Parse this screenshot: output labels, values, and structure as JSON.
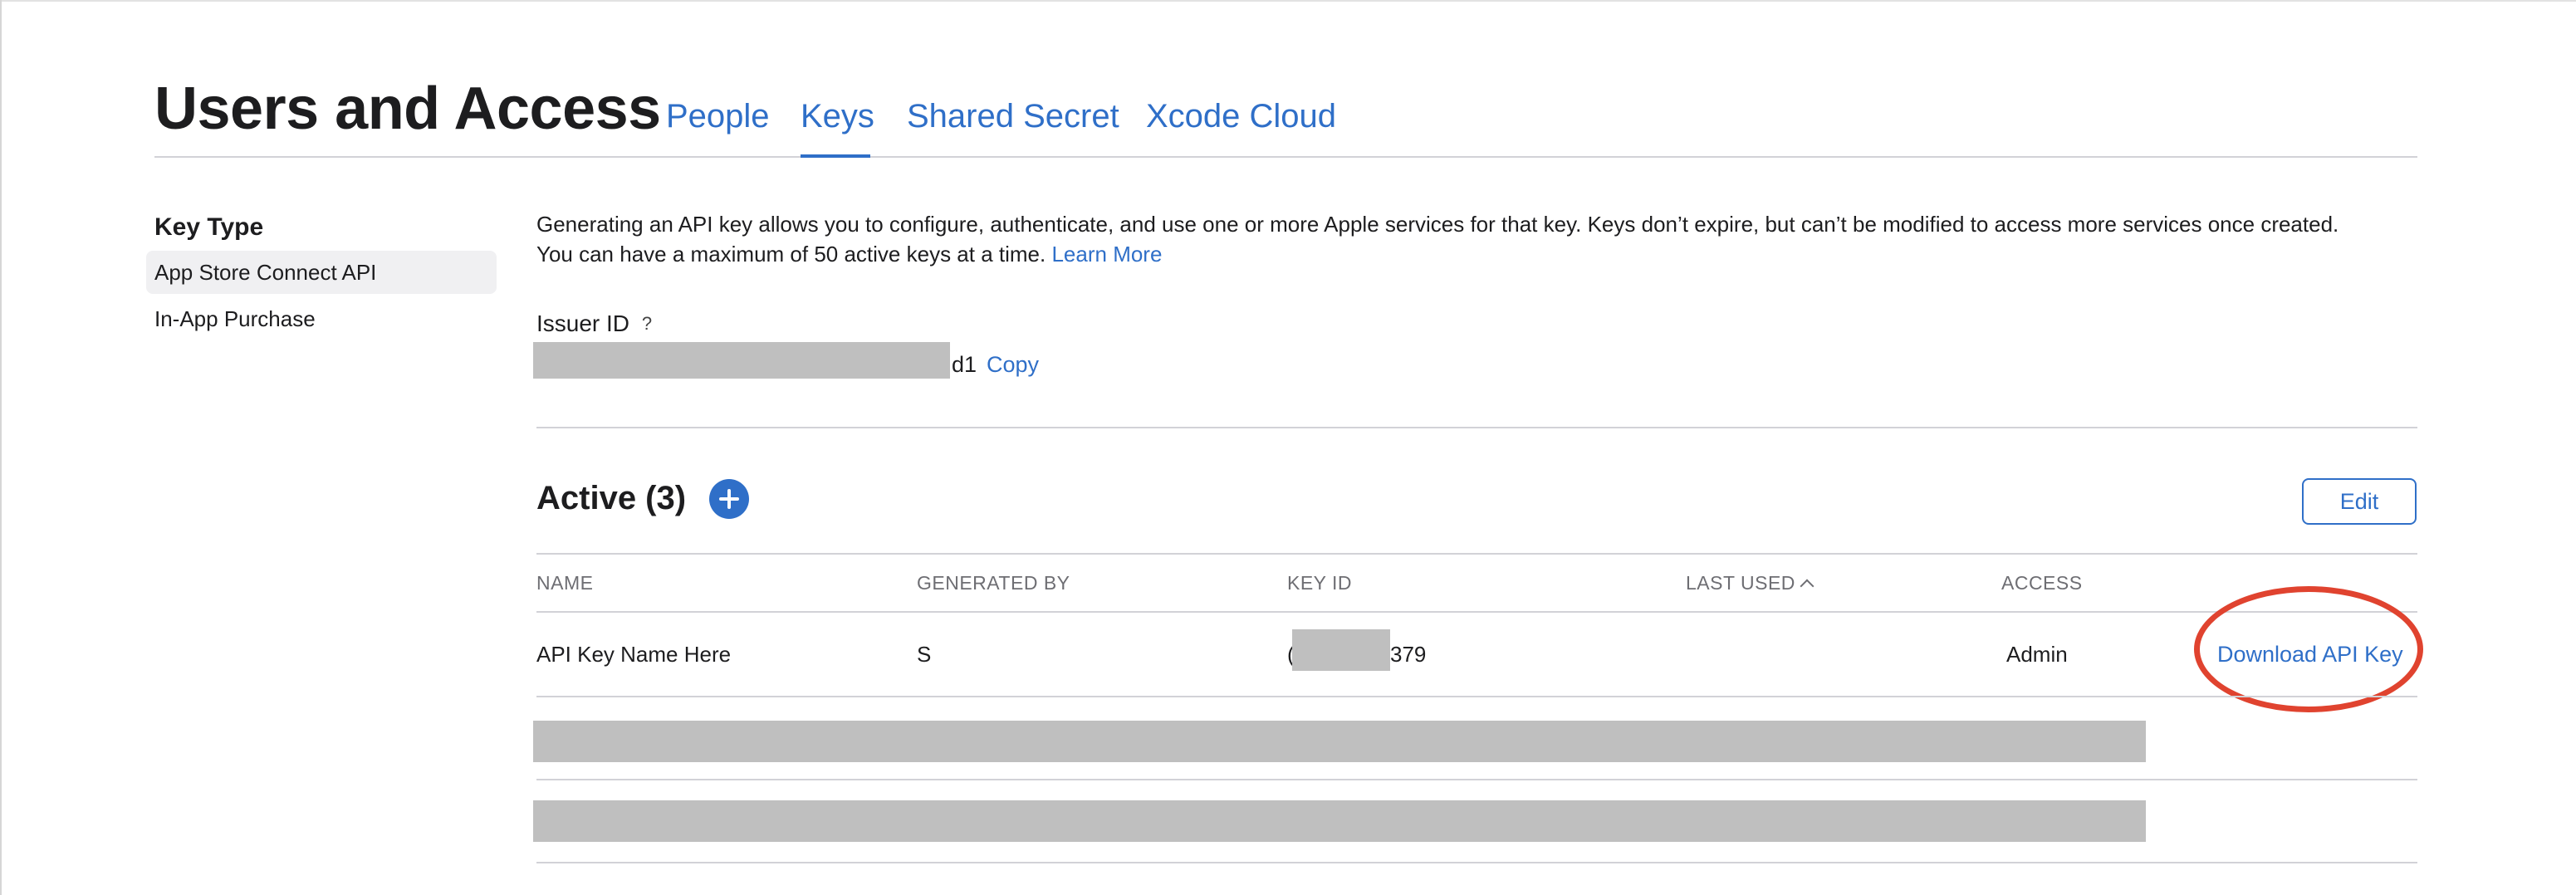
{
  "header": {
    "title": "Users and Access",
    "tabs": [
      {
        "label": "People"
      },
      {
        "label": "Keys"
      },
      {
        "label": "Shared Secret"
      },
      {
        "label": "Xcode Cloud"
      }
    ],
    "active_tab": "Keys"
  },
  "sidebar": {
    "title": "Key Type",
    "items": [
      {
        "label": "App Store Connect API",
        "selected": true
      },
      {
        "label": "In-App Purchase",
        "selected": false
      }
    ]
  },
  "intro": {
    "line1": "Generating an API key allows you to configure, authenticate, and use one or more Apple services for that key. Keys don’t expire, but can’t be modified to access more services once created.",
    "line2": "You can have a maximum of 50 active keys at a time. ",
    "learn_more": "Learn More"
  },
  "issuer": {
    "label": "Issuer ID",
    "help": "?",
    "visible_tail": "d1",
    "copy_label": "Copy"
  },
  "active": {
    "title": "Active (3)",
    "add_label": "+",
    "edit_label": "Edit",
    "columns": [
      "NAME",
      "GENERATED BY",
      "KEY ID",
      "LAST USED",
      "ACCESS"
    ],
    "rows": [
      {
        "name": "API Key Name Here",
        "generated_by_visible": "S",
        "key_id_visible_prefix": "(",
        "key_id_visible_suffix": "379",
        "last_used": "",
        "access": "Admin",
        "action": "Download API Key"
      }
    ]
  },
  "colors": {
    "accent": "#2f6fc8",
    "highlight": "#e0432f",
    "redaction": "#bfbfbf"
  }
}
